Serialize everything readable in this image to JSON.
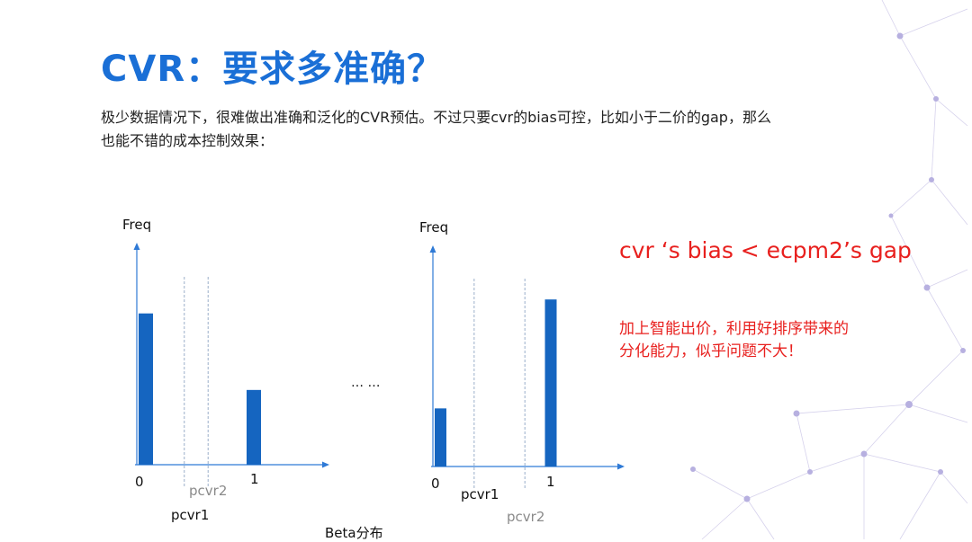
{
  "slide": {
    "title": "CVR：要求多准确？",
    "body_lines": [
      "极少数据情况下，很难做出准确和泛化的CVR预估。不过只要cvr的bias可控，比如小于二价的gap，那么",
      "也能不错的成本控制效果："
    ],
    "formula": "cvr ‘s bias  <   ecpm2’s gap",
    "note_lines": [
      "加上智能出价，利用好排序带来的",
      "分化能力，似乎问题不大！"
    ],
    "ellipsis": "… …",
    "caption": "Beta分布"
  },
  "colors": {
    "title": "#1a6fd6",
    "bar": "#1565c0",
    "axis": "#2f7ad6",
    "emphasis": "#e8201e"
  },
  "chart_data": [
    {
      "type": "bar",
      "ylabel": "Freq",
      "x_tick_labels": [
        "0",
        "1"
      ],
      "bars": [
        {
          "x": 0,
          "value": 0.85
        },
        {
          "x": 1,
          "value": 0.42
        }
      ],
      "markers": [
        {
          "label": "pcvr1",
          "x": 0.4,
          "style": "dashed"
        },
        {
          "label": "pcvr2",
          "x": 0.6,
          "style": "dashed",
          "color": "gray"
        }
      ]
    },
    {
      "type": "bar",
      "ylabel": "Freq",
      "x_tick_labels": [
        "0",
        "1"
      ],
      "bars": [
        {
          "x": 0,
          "value": 0.32
        },
        {
          "x": 1,
          "value": 0.92
        }
      ],
      "markers": [
        {
          "label": "pcvr1",
          "x": 0.35,
          "style": "dashed"
        },
        {
          "label": "pcvr2",
          "x": 0.78,
          "style": "dashed",
          "color": "gray"
        }
      ]
    }
  ]
}
